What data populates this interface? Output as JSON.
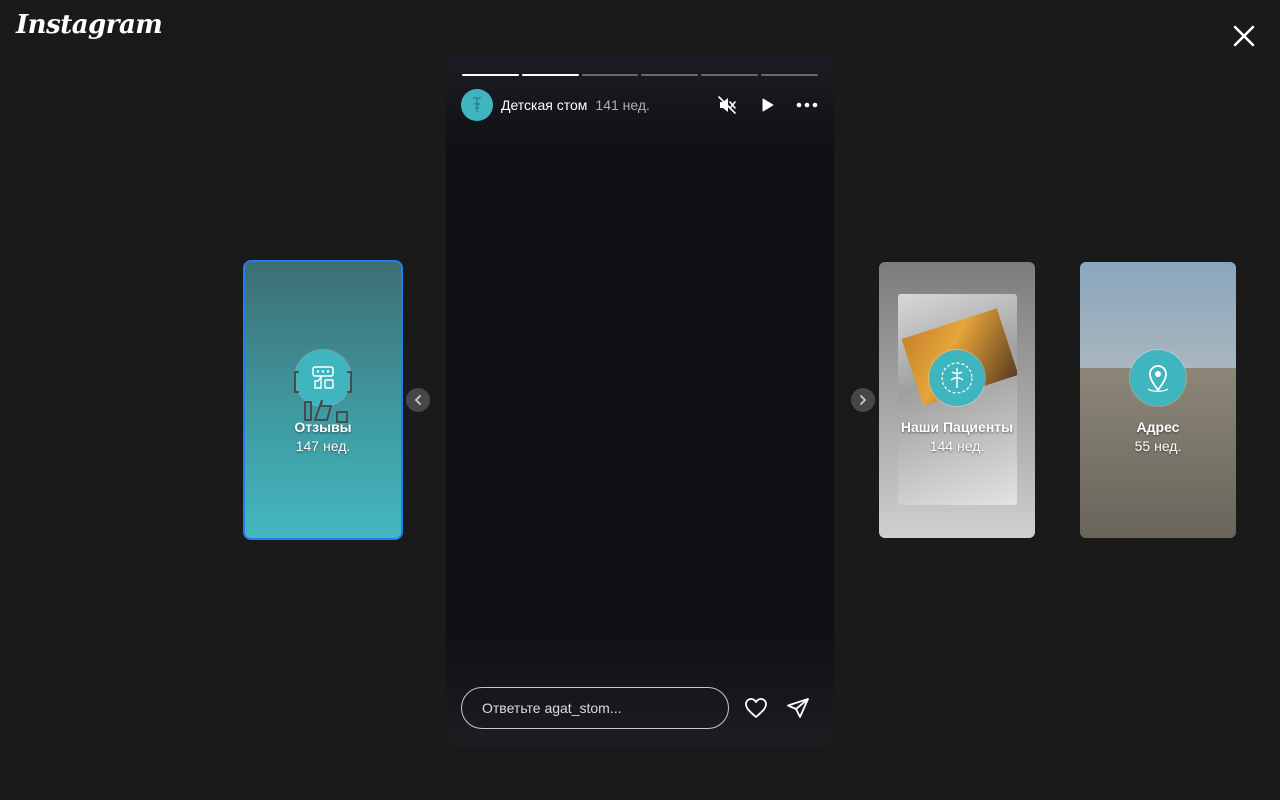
{
  "app": {
    "logo_text": "Instagram"
  },
  "story": {
    "username": "Детская стом",
    "time": "141 нед.",
    "progress": {
      "segments": 6,
      "completed": 2
    },
    "reply_placeholder": "Ответьте agat_stom..."
  },
  "highlights": [
    {
      "title": "Отзывы",
      "time": "147 нед.",
      "icon": "reviews-icon",
      "selected": true
    },
    {
      "title": "Наши Пациенты",
      "time": "144 нед.",
      "icon": "patients-icon"
    },
    {
      "title": "Адрес",
      "time": "55 нед.",
      "icon": "location-pin-icon"
    }
  ],
  "colors": {
    "accent": "#1d7ff0",
    "brand_teal": "#3fb6bf",
    "background": "#1a1a1a"
  }
}
